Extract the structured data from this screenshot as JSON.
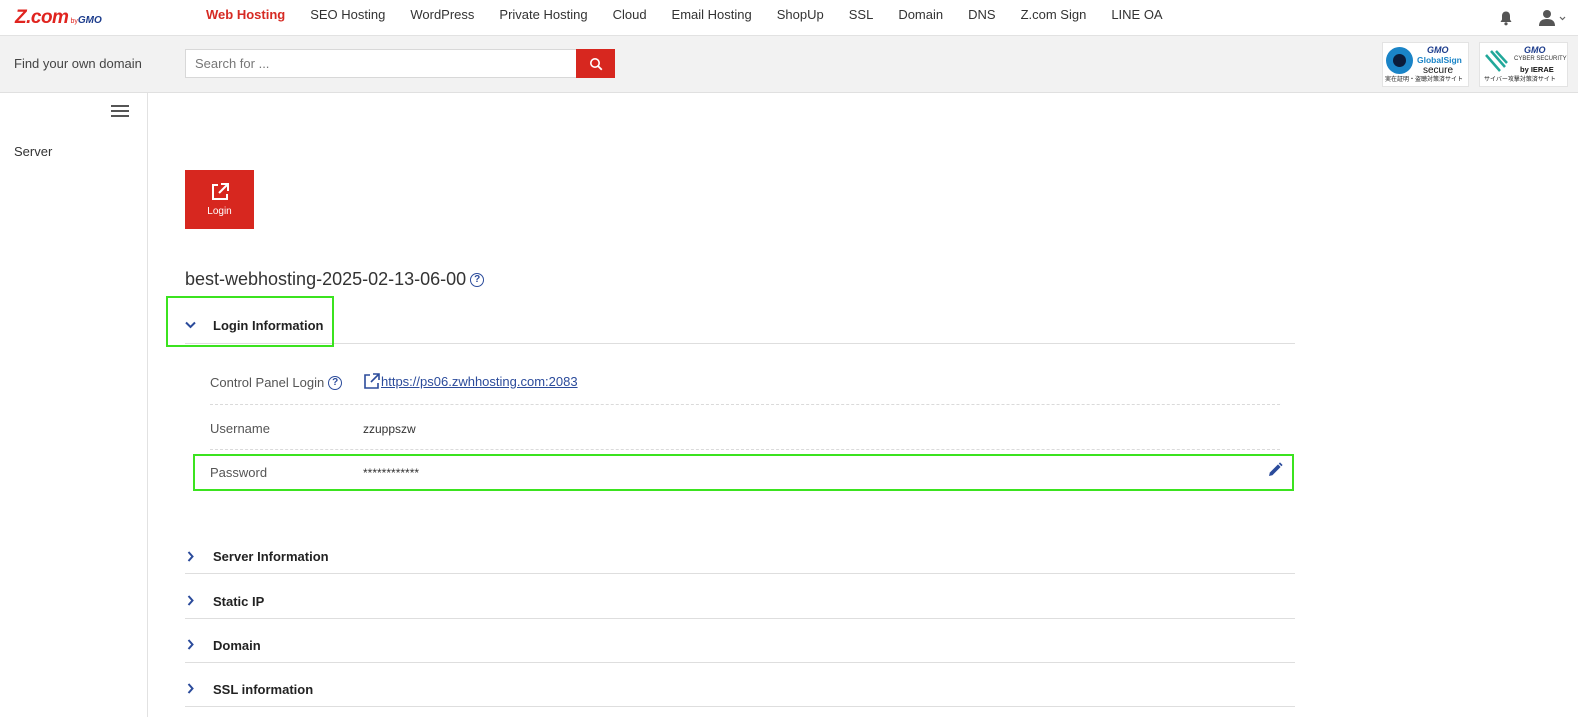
{
  "brand": {
    "logo_main": "Z.com",
    "logo_by": "by",
    "logo_gmo": "GMO"
  },
  "nav": {
    "items": [
      "Web Hosting",
      "SEO Hosting",
      "WordPress",
      "Private Hosting",
      "Cloud",
      "Email Hosting",
      "ShopUp",
      "SSL",
      "Domain",
      "DNS",
      "Z.com Sign",
      "LINE OA"
    ],
    "active": "Web Hosting"
  },
  "search": {
    "label": "Find your own domain",
    "placeholder": "Search for ...",
    "value": ""
  },
  "badges": {
    "globalsign": {
      "gmo": "GMO",
      "name": "GlobalSign",
      "secure": "secure",
      "caption": "実在証明・盗聴対策済サイト"
    },
    "ierae": {
      "gmo": "GMO",
      "name": "CYBER SECURITY",
      "by": "by IERAE",
      "caption": "サイバー攻撃対策済サイト"
    }
  },
  "sidebar": {
    "items": [
      "Server"
    ]
  },
  "login_tile": {
    "label": "Login"
  },
  "page": {
    "title": "best-webhosting-2025-02-13-06-00"
  },
  "sections": {
    "login_info": {
      "title": "Login Information",
      "expanded": true,
      "rows": {
        "control_panel": {
          "label": "Control Panel Login",
          "value": " https://ps06.zwhhosting.com:2083"
        },
        "username": {
          "label": "Username",
          "value": "zzuppszw"
        },
        "password": {
          "label": "Password",
          "value": "************"
        }
      }
    },
    "collapsed": [
      "Server Information",
      "Static IP",
      "Domain",
      "SSL information"
    ]
  },
  "colors": {
    "brand_red": "#d7271f",
    "accent_blue": "#2b4b9b",
    "highlight_green": "#3be31f"
  }
}
